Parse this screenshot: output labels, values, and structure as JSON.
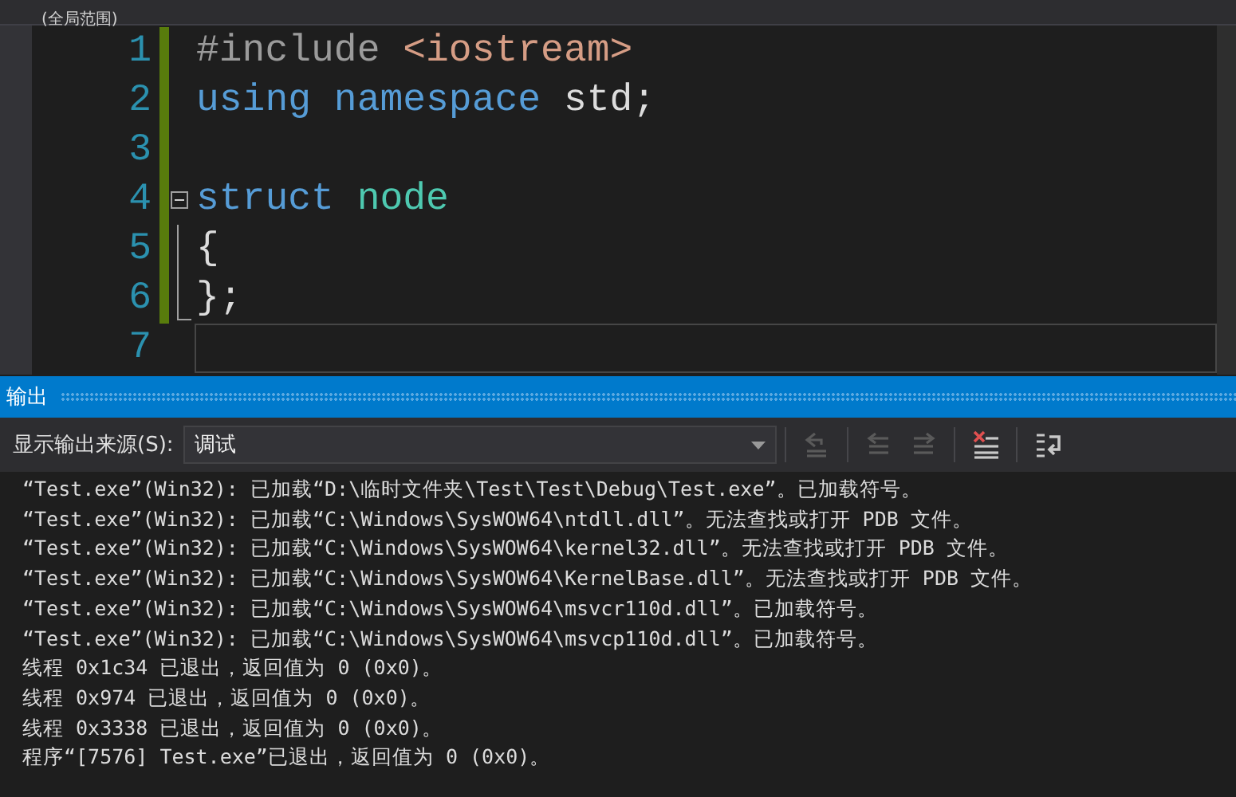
{
  "scope_bar": {
    "text": "(全局范围)"
  },
  "editor": {
    "lines": [
      {
        "number": "1",
        "changed": true,
        "in_fold": false,
        "current": false,
        "tokens": [
          {
            "kind": "preprocessor",
            "text": "#include"
          },
          {
            "kind": "string",
            "text": "<iostream>"
          }
        ]
      },
      {
        "number": "2",
        "changed": true,
        "in_fold": false,
        "current": false,
        "tokens": [
          {
            "kind": "keyword",
            "text": "using"
          },
          {
            "kind": "keyword",
            "text": "namespace"
          },
          {
            "kind": "plain",
            "text": "std;"
          }
        ]
      },
      {
        "number": "3",
        "changed": true,
        "in_fold": false,
        "current": false
      },
      {
        "number": "4",
        "changed": true,
        "in_fold": false,
        "current": false,
        "fold_toggle": {
          "expanded": true
        },
        "tokens": [
          {
            "kind": "keyword",
            "text": "struct"
          },
          {
            "kind": "type",
            "text": "node"
          }
        ]
      },
      {
        "number": "5",
        "changed": true,
        "in_fold": true,
        "current": false,
        "tokens": [
          {
            "kind": "plain",
            "text": "{"
          }
        ]
      },
      {
        "number": "6",
        "changed": true,
        "in_fold": true,
        "current": false,
        "tokens": [
          {
            "kind": "plain",
            "text": "};"
          }
        ]
      },
      {
        "number": "7",
        "changed": false,
        "in_fold": false,
        "current": true
      }
    ]
  },
  "output": {
    "title": "输出",
    "source_label": "显示输出来源(S):",
    "source_value": "调试",
    "tools": [
      {
        "kind": "goto",
        "disabled": true
      },
      {
        "kind": "prev",
        "disabled": true
      },
      {
        "kind": "next",
        "disabled": true
      },
      {
        "kind": "clear",
        "disabled": false
      },
      {
        "kind": "wrap",
        "disabled": false
      }
    ],
    "lines": [
      "“Test.exe”(Win32): 已加载“D:\\临时文件夹\\Test\\Test\\Debug\\Test.exe”。已加载符号。",
      "“Test.exe”(Win32): 已加载“C:\\Windows\\SysWOW64\\ntdll.dll”。无法查找或打开 PDB 文件。",
      "“Test.exe”(Win32): 已加载“C:\\Windows\\SysWOW64\\kernel32.dll”。无法查找或打开 PDB 文件。",
      "“Test.exe”(Win32): 已加载“C:\\Windows\\SysWOW64\\KernelBase.dll”。无法查找或打开 PDB 文件。",
      "“Test.exe”(Win32): 已加载“C:\\Windows\\SysWOW64\\msvcr110d.dll”。已加载符号。",
      "“Test.exe”(Win32): 已加载“C:\\Windows\\SysWOW64\\msvcp110d.dll”。已加载符号。",
      "线程 0x1c34 已退出，返回值为 0 (0x0)。",
      "线程 0x974 已退出，返回值为 0 (0x0)。",
      "线程 0x3338 已退出，返回值为 0 (0x0)。",
      "程序“[7576] Test.exe”已退出，返回值为 0 (0x0)。"
    ]
  }
}
